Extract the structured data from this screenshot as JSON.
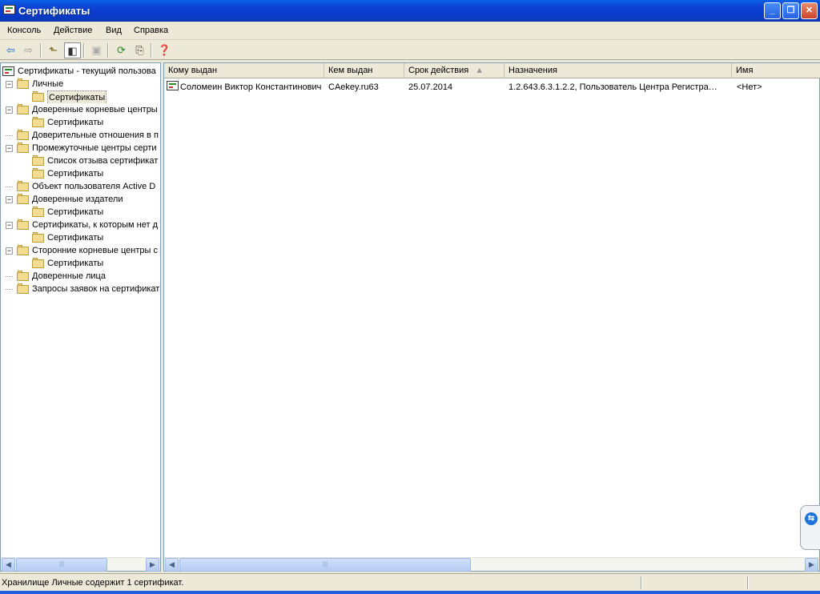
{
  "window": {
    "title": "Сертификаты"
  },
  "menu": [
    "Консоль",
    "Действие",
    "Вид",
    "Справка"
  ],
  "toolbar": [
    "back-arrow-icon",
    "forward-arrow-icon",
    "up-folder-icon",
    "show-tree-icon",
    "delete-icon",
    "refresh-icon",
    "export-list-icon",
    "properties-help-icon"
  ],
  "tree": {
    "root": "Сертификаты - текущий пользова",
    "nodes": [
      {
        "label": "Личные",
        "level": 1,
        "expanded": true
      },
      {
        "label": "Сертификаты",
        "level": 2,
        "selected": true,
        "open": true
      },
      {
        "label": "Доверенные корневые центры",
        "level": 1,
        "expanded": true
      },
      {
        "label": "Сертификаты",
        "level": 2
      },
      {
        "label": "Доверительные отношения в п",
        "level": 1
      },
      {
        "label": "Промежуточные центры серти",
        "level": 1,
        "expanded": true
      },
      {
        "label": "Список отзыва сертификат",
        "level": 2
      },
      {
        "label": "Сертификаты",
        "level": 2
      },
      {
        "label": "Объект пользователя Active D",
        "level": 1
      },
      {
        "label": "Доверенные издатели",
        "level": 1,
        "expanded": true
      },
      {
        "label": "Сертификаты",
        "level": 2
      },
      {
        "label": "Сертификаты, к которым нет д",
        "level": 1,
        "expanded": true
      },
      {
        "label": "Сертификаты",
        "level": 2
      },
      {
        "label": "Сторонние корневые центры с",
        "level": 1,
        "expanded": true
      },
      {
        "label": "Сертификаты",
        "level": 2
      },
      {
        "label": "Доверенные лица",
        "level": 1
      },
      {
        "label": "Запросы заявок на сертификат",
        "level": 1
      }
    ]
  },
  "list": {
    "columns": [
      "Кому выдан",
      "Кем выдан",
      "Срок действия",
      "Назначения",
      "Имя"
    ],
    "sorted_column": "Срок действия",
    "rows": [
      {
        "issued_to": "Соломеин Виктор Константинович",
        "issued_by": "CAekey.ru63",
        "expires": "25.07.2014",
        "purposes": "1.2.643.6.3.1.2.2, Пользователь Центра Регистра…",
        "name": "<Нет>"
      }
    ]
  },
  "status": {
    "text": "Хранилище Личные содержит 1 сертификат."
  },
  "colors": {
    "titlebar": "#0a3ac4",
    "chrome": "#ece9d8",
    "scroll": "#b8cdf3"
  }
}
